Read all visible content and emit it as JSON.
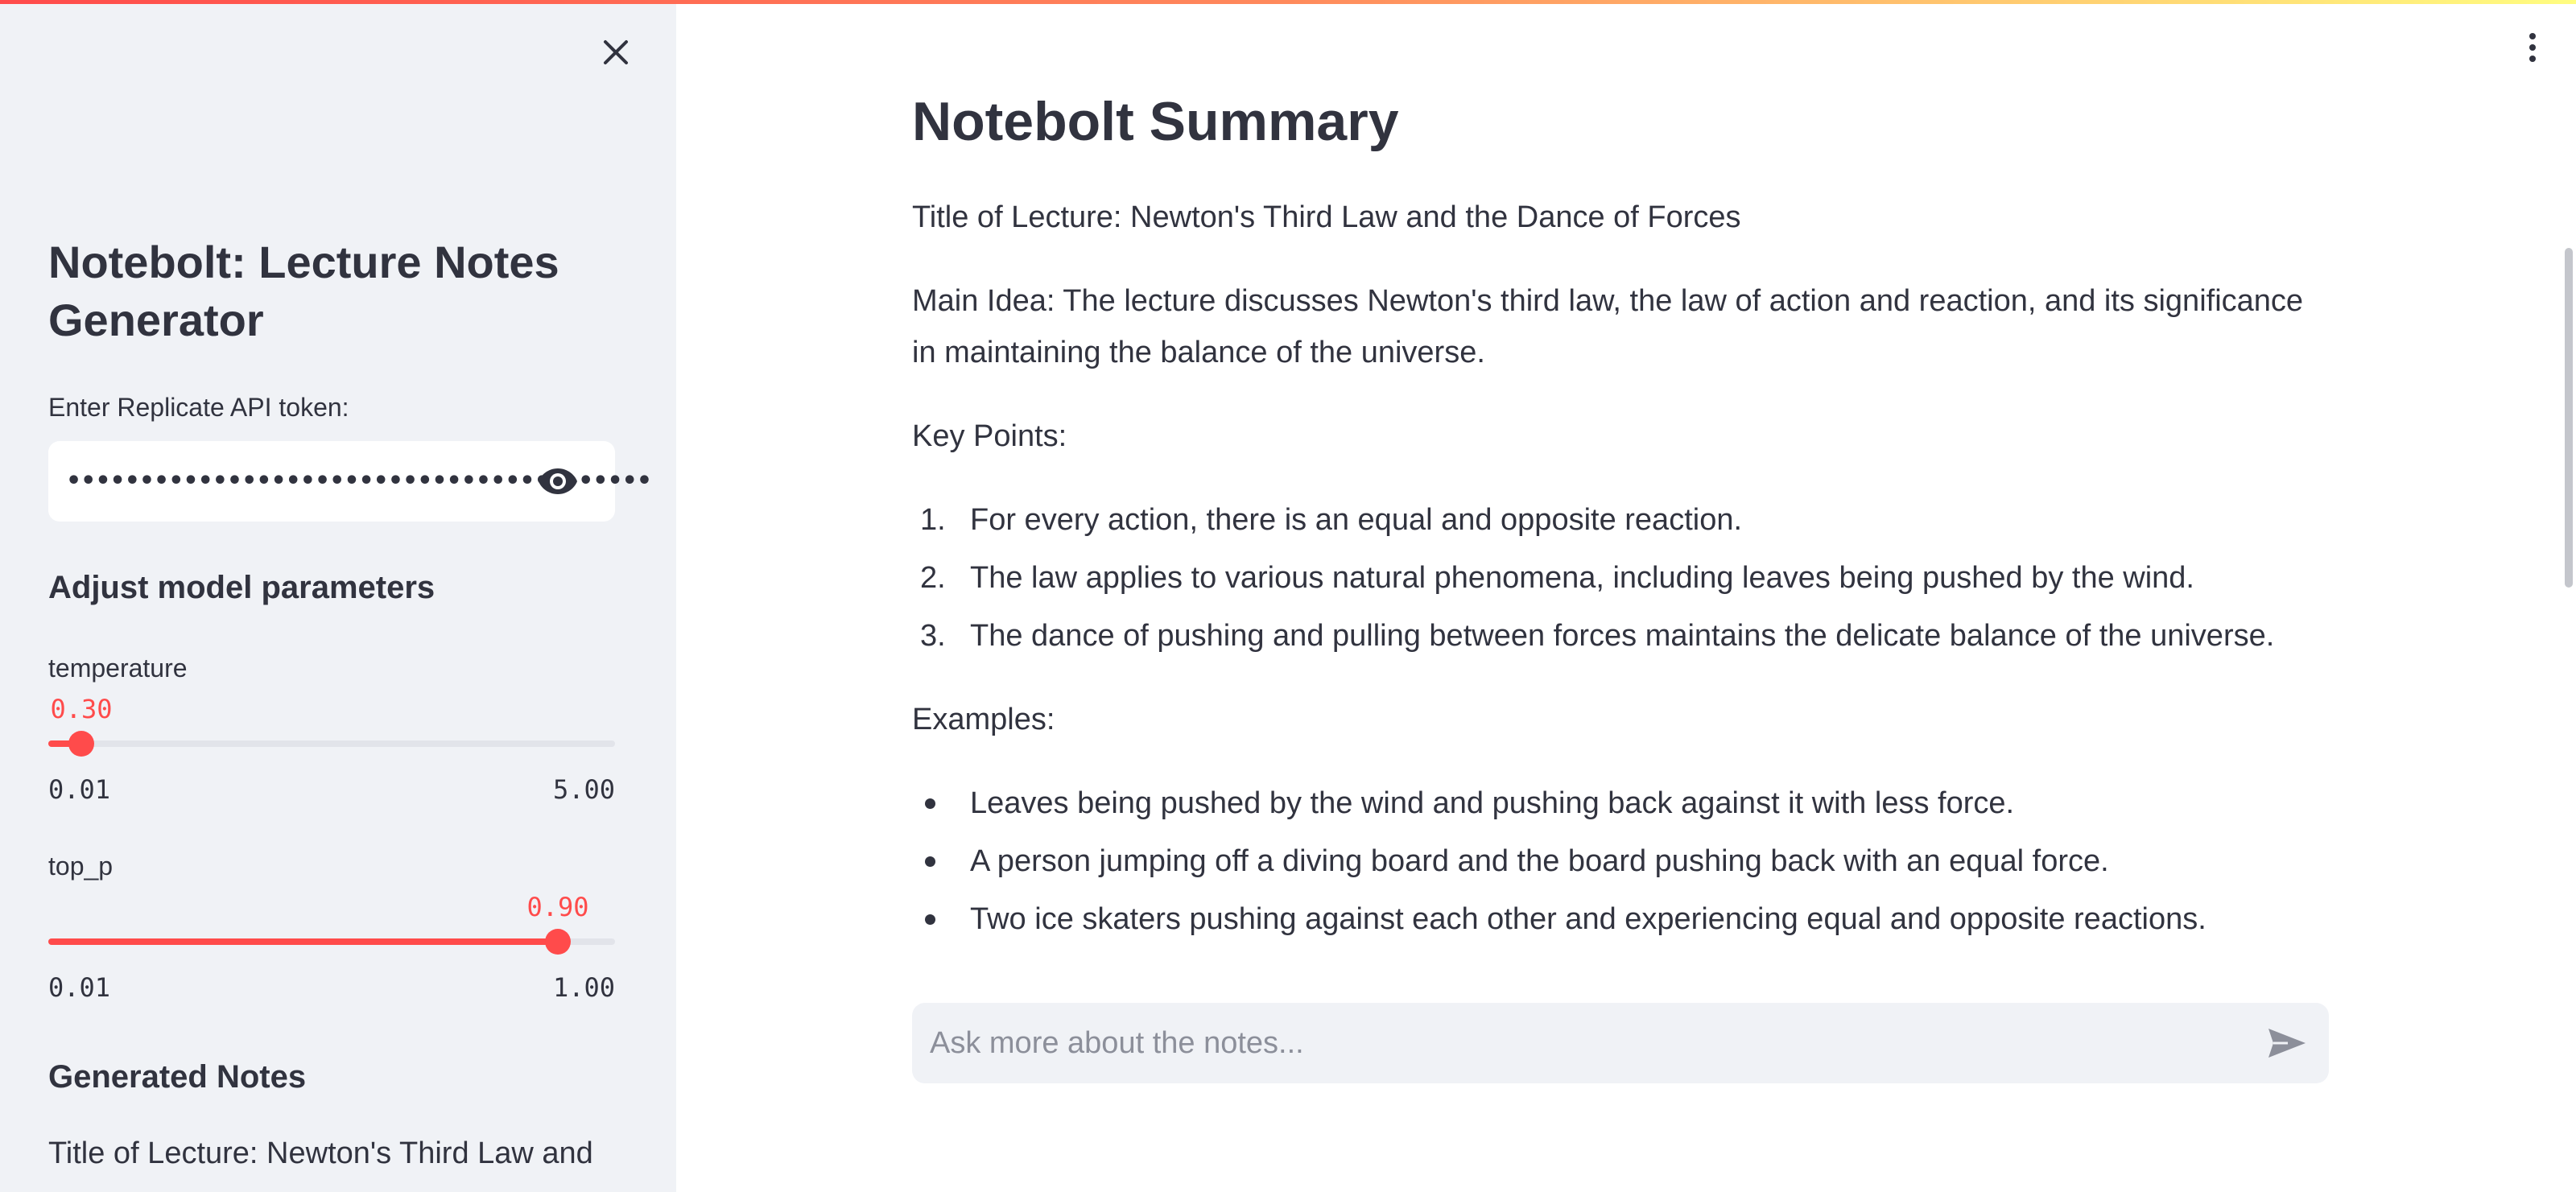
{
  "sidebar": {
    "title": "Notebolt: Lecture Notes Generator",
    "token_label": "Enter Replicate API token:",
    "token_value": "••••••••••••••••••••••••••••••••••••••••",
    "params_heading": "Adjust model parameters",
    "temperature": {
      "label": "temperature",
      "value": "0.30",
      "min": "0.01",
      "max": "5.00",
      "fraction": 0.058
    },
    "top_p": {
      "label": "top_p",
      "value": "0.90",
      "min": "0.01",
      "max": "1.00",
      "fraction": 0.899
    },
    "generated_heading": "Generated Notes",
    "generated_preview": "Title of Lecture: Newton's Third Law and"
  },
  "main": {
    "title": "Notebolt Summary",
    "lecture_title": "Title of Lecture: Newton's Third Law and the Dance of Forces",
    "main_idea": "Main Idea: The lecture discusses Newton's third law, the law of action and reaction, and its significance in maintaining the balance of the universe.",
    "key_points_label": "Key Points:",
    "key_points": [
      {
        "num": "1.",
        "text": "For every action, there is an equal and opposite reaction."
      },
      {
        "num": "2.",
        "text": "The law applies to various natural phenomena, including leaves being pushed by the wind."
      },
      {
        "num": "3.",
        "text": "The dance of pushing and pulling between forces maintains the delicate balance of the universe."
      }
    ],
    "examples_label": "Examples:",
    "examples": [
      "Leaves being pushed by the wind and pushing back against it with less force.",
      "A person jumping off a diving board and the board pushing back with an equal force.",
      "Two ice skaters pushing against each other and experiencing equal and opposite reactions."
    ]
  },
  "chat": {
    "placeholder": "Ask more about the notes..."
  },
  "icons": {
    "close": "close-icon",
    "eye": "eye-icon",
    "menu": "kebab-menu-icon",
    "send": "send-icon"
  },
  "colors": {
    "accent": "#ff4b4b",
    "sidebar_bg": "#f0f2f6",
    "text": "#31333f"
  }
}
